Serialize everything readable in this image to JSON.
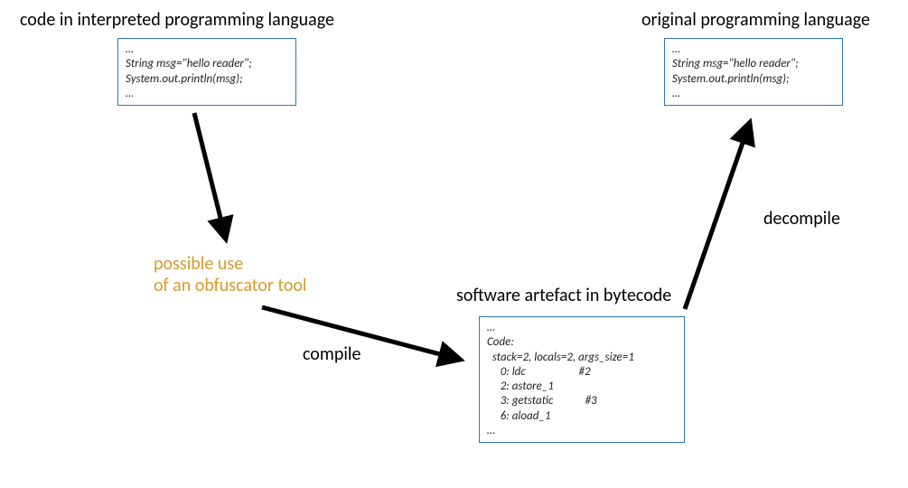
{
  "labels": {
    "sourceTitle": "code in interpreted programming language",
    "originalTitle": "original programming language",
    "obfuscator": "possible use\nof an obfuscator tool",
    "bytecodeTitle": "software artefact in bytecode",
    "compile": "compile",
    "decompile": "decompile"
  },
  "codeboxes": {
    "source": "…\nString msg=\"hello reader\";\nSystem.out.println(msg);\n…",
    "original": "…\nString msg=\"hello reader\";\nSystem.out.println(msg);\n…",
    "bytecode": "…\nCode:\n  stack=2, locals=2, args_size=1\n     0: ldc                    #2\n     2: astore_1\n     3: getstatic            #3\n     6: aload_1\n…"
  },
  "colors": {
    "boxBorder": "#2e74b5",
    "accent": "#d79a2b",
    "arrow": "#000000"
  }
}
